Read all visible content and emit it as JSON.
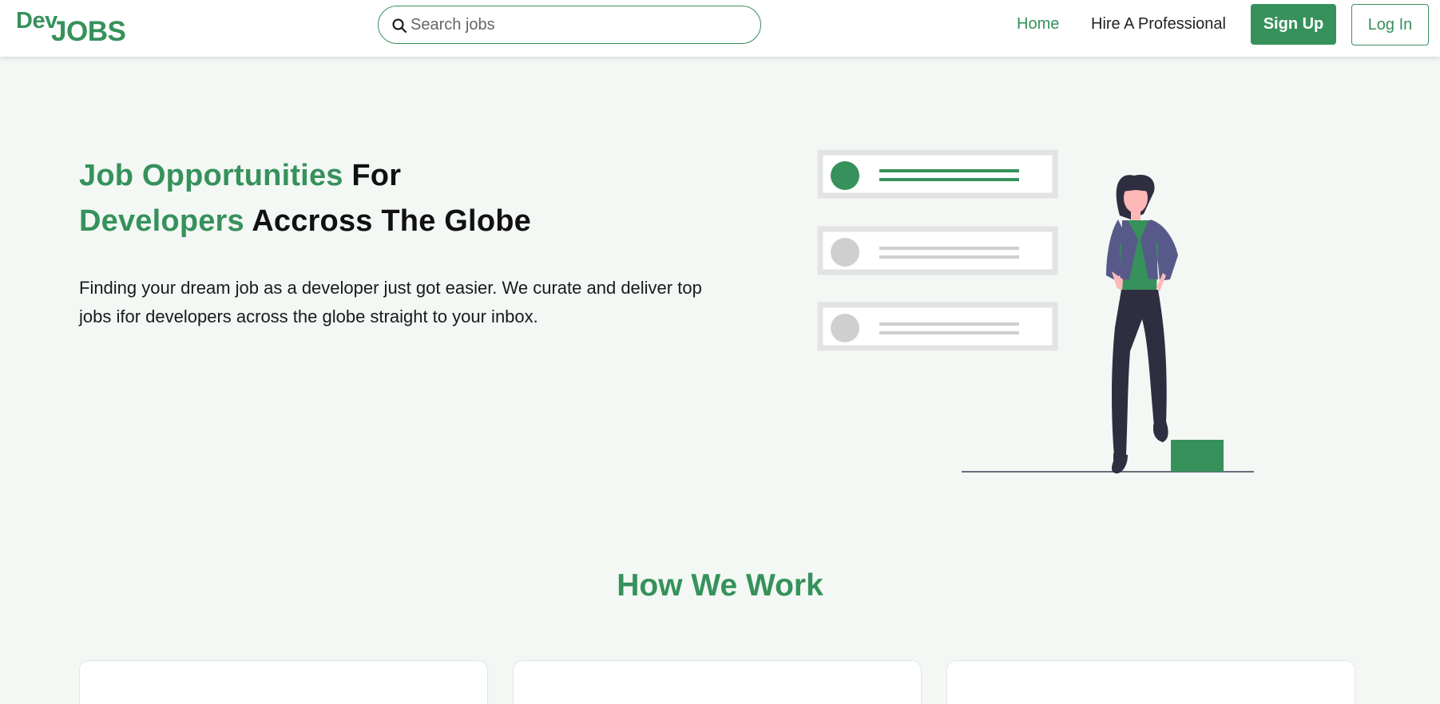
{
  "header": {
    "logo": {
      "part1": "Dev",
      "part2": "JOBS"
    },
    "search": {
      "placeholder": "Search jobs",
      "value": ""
    },
    "nav": {
      "home": "Home",
      "hire": "Hire A Professional"
    },
    "buttons": {
      "signup": "Sign Up",
      "login": "Log In"
    }
  },
  "hero": {
    "title_line1_accent": "Job Opportunities",
    "title_line1_dark": "For",
    "title_line2_accent": "Developers",
    "title_line2_dark": "Accross The Globe",
    "description": "Finding your dream job as a developer just got easier. We curate and deliver top jobs ifor developers across the globe straight to your inbox."
  },
  "how_we_work": {
    "title": "How We Work"
  },
  "colors": {
    "accent": "#36915b",
    "background": "#f3f8f4",
    "navbar": "#ffffff",
    "text_dark": "#111111"
  },
  "icons": [
    "search-icon"
  ]
}
